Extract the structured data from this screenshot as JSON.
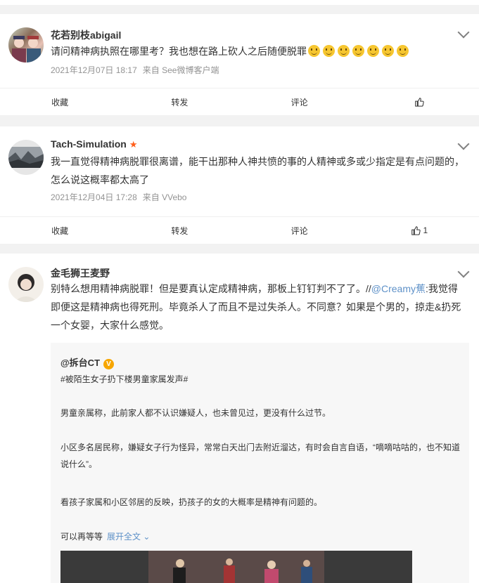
{
  "posts": [
    {
      "username": "花若别枝abigail",
      "text": "请问精神病执照在哪里考？我也想在路上砍人之后随便脱罪",
      "emoji_count": 7,
      "emoji_icon": "smile-emoji",
      "date": "2021年12月07日 18:17",
      "source": "来自 See微博客户端",
      "actions": {
        "collect": "收藏",
        "repost": "转发",
        "comment": "评论",
        "like_count": ""
      }
    },
    {
      "username": "Tach-Simulation",
      "badge_icon": "star-icon",
      "text": "我一直觉得精神病脱罪很离谱，能干出那种人神共愤的事的人精神或多或少指定是有点问题的，怎么说这概率都太高了",
      "date": "2021年12月04日 17:28",
      "source": "来自 VVebo",
      "actions": {
        "collect": "收藏",
        "repost": "转发",
        "comment": "评论",
        "like_count": "1"
      }
    },
    {
      "username": "金毛狮王麦野",
      "text_before": "别特么想用精神病脱罪！但是要真认定成精神病，那板上钉钉判不了了。//",
      "mention": "@Creamy蕉",
      "text_after": ":我觉得即便这是精神病也得死刑。毕竟杀人了而且不是过失杀人。不同意？如果是个男的，掠走&扔死一个女婴，大家什么感觉。",
      "repost": {
        "author": "@拆台CT",
        "hashtag": "#被陌生女子扔下楼男童家属发声#",
        "paragraphs": [
          "男童亲属称，此前家人都不认识嫌疑人，也未曾见过，更没有什么过节。",
          "小区多名居民称，嫌疑女子行为怪异，常常白天出门去附近溜达，有时会自言自语，“嘀嘀咕咕的，也不知道说什么”。",
          "看孩子家属和小区邻居的反映，扔孩子的女的大概率是精神有问题的。",
          "可以再等等"
        ],
        "expand": "展开全文"
      }
    }
  ],
  "colors": {
    "link": "#5e91c8",
    "star": "#ff5e1a",
    "verified": "#f7a600",
    "meta": "#939393"
  }
}
